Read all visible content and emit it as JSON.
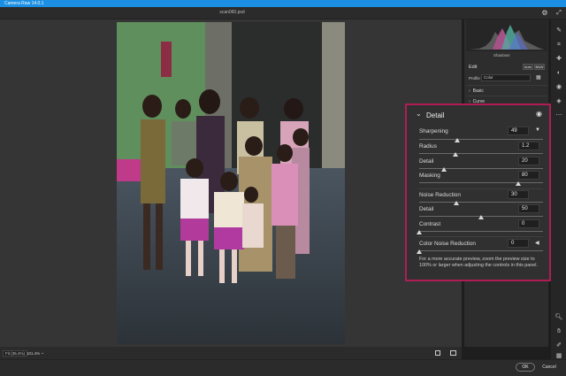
{
  "window": {
    "title": "Camera Raw 14.0.1",
    "filename": "scan060.psd"
  },
  "right_panel": {
    "histogram_label": "Shadows",
    "edit_label": "Edit",
    "auto_label": "Auto",
    "bw_label": "B&W",
    "profile_label": "Profile",
    "profile_value": "Color",
    "sections": [
      "Basic",
      "Curve"
    ]
  },
  "detail": {
    "title": "Detail",
    "sharpening": {
      "label": "Sharpening",
      "value": "49",
      "fraction": 0.31
    },
    "radius": {
      "label": "Radius",
      "value": "1.2",
      "fraction": 0.29
    },
    "detail": {
      "label": "Detail",
      "value": "20",
      "fraction": 0.2
    },
    "masking": {
      "label": "Masking",
      "value": "80",
      "fraction": 0.8
    },
    "noise_reduction": {
      "label": "Noise Reduction",
      "value": "30",
      "fraction": 0.3
    },
    "nr_detail": {
      "label": "Detail",
      "value": "50",
      "fraction": 0.5
    },
    "nr_contrast": {
      "label": "Contrast",
      "value": "0",
      "fraction": 0.0
    },
    "color_noise_reduction": {
      "label": "Color Noise Reduction",
      "value": "0",
      "fraction": 0.0
    },
    "note": "For a more accurate preview, zoom the preview size to 100% or larger when adjusting the controls in this panel."
  },
  "bottom": {
    "zoom_fit": "Fit (35.4%)",
    "zoom_value": "101.4%"
  },
  "footer": {
    "ok": "OK",
    "cancel": "Cancel"
  },
  "colors": {
    "title_bar": "#1a8fe3",
    "highlight_border": "#b01c55"
  },
  "icons": [
    "gear-icon",
    "edit-icon",
    "crop-icon",
    "heal-icon",
    "mask-icon",
    "redeye-icon",
    "presets-icon",
    "more-icon",
    "zoom-icon",
    "hand-icon",
    "sampler-icon",
    "grid-icon",
    "eye-icon",
    "chevron-down-icon"
  ]
}
